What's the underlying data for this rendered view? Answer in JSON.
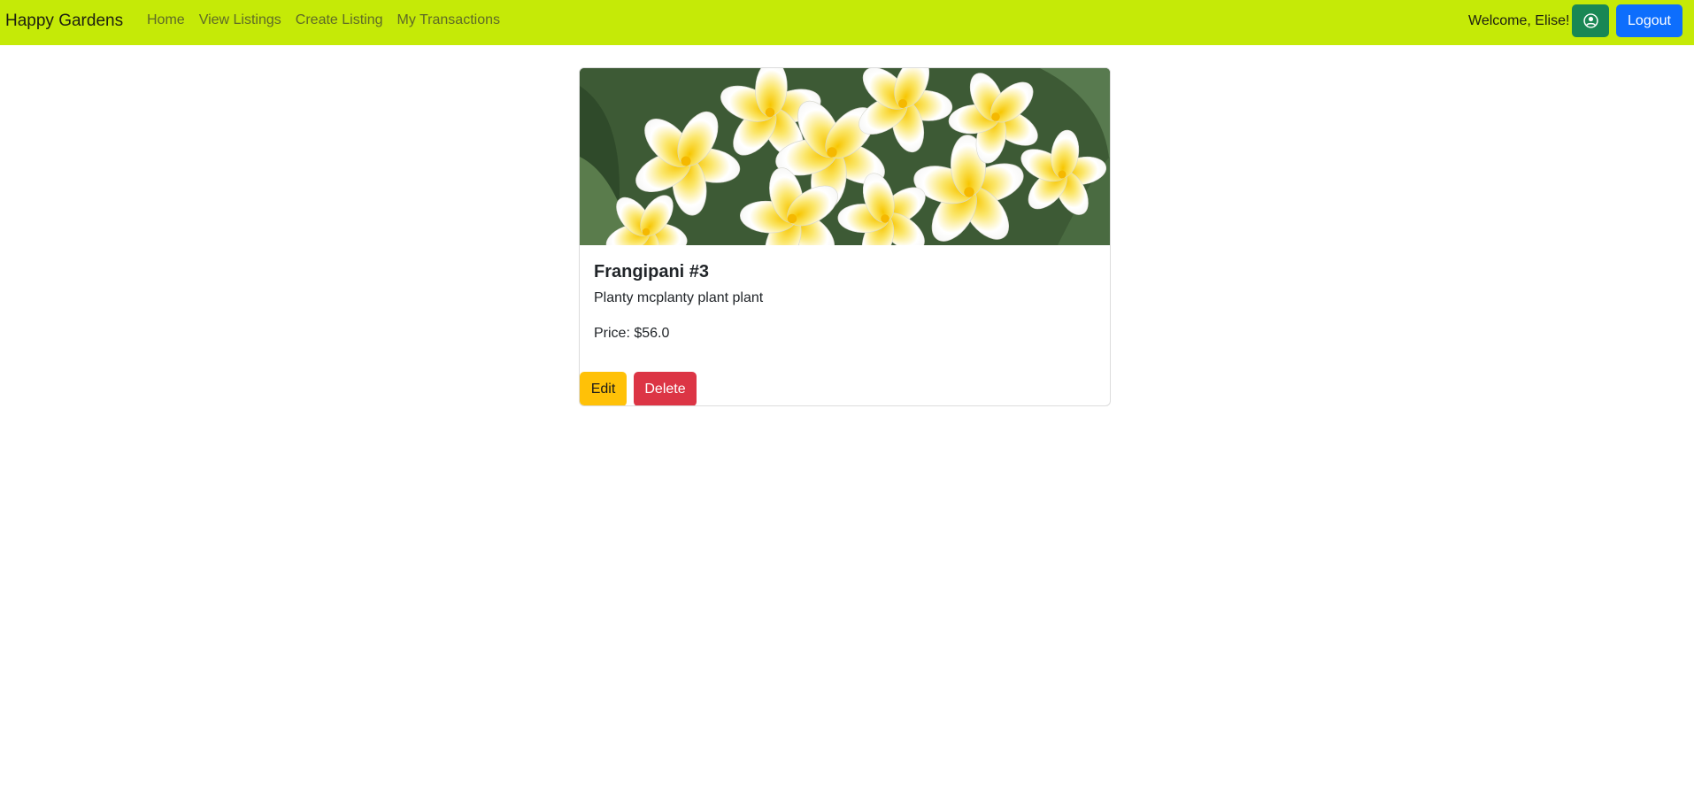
{
  "colors": {
    "navbar_bg": "#c5ea07",
    "profile_button": "#198754",
    "logout_button": "#0d6efd",
    "edit_button": "#ffc107",
    "delete_button": "#dc3545"
  },
  "navbar": {
    "brand": "Happy Gardens",
    "links": [
      {
        "label": "Home"
      },
      {
        "label": "View Listings"
      },
      {
        "label": "Create Listing"
      },
      {
        "label": "My Transactions"
      }
    ],
    "welcome": "Welcome, Elise!",
    "profile_icon": "user-circle-icon",
    "logout_label": "Logout"
  },
  "listing": {
    "image": "frangipani-flowers-photo",
    "title": "Frangipani #3",
    "description": "Planty mcplanty plant plant",
    "price": "Price: $56.0",
    "edit_label": "Edit",
    "delete_label": "Delete"
  }
}
